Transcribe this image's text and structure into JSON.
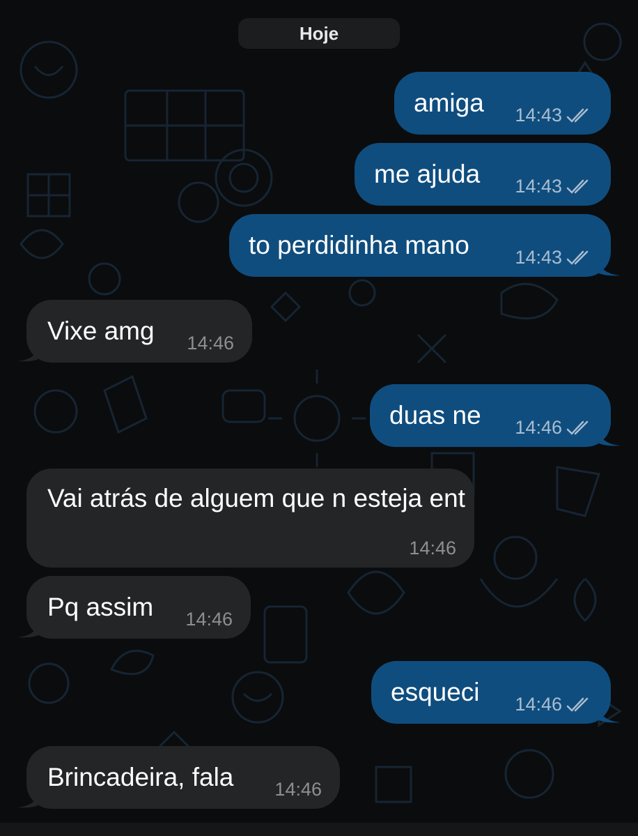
{
  "date_divider": "Hoje",
  "messages": [
    {
      "dir": "out",
      "text": "amiga",
      "time": "14:43",
      "status": "double-check-read-icon"
    },
    {
      "dir": "out",
      "text": "me ajuda",
      "time": "14:43",
      "status": "double-check-read-icon"
    },
    {
      "dir": "out",
      "text": "to perdidinha mano",
      "time": "14:43",
      "status": "double-check-read-icon"
    },
    {
      "dir": "in",
      "text": "Vixe amg",
      "time": "14:46"
    },
    {
      "dir": "out",
      "text": "duas ne",
      "time": "14:46",
      "status": "double-check-read-icon"
    },
    {
      "dir": "in",
      "text": "Vai atrás de alguem que n esteja ent",
      "time": "14:46"
    },
    {
      "dir": "in",
      "text": "Pq assim",
      "time": "14:46"
    },
    {
      "dir": "out",
      "text": "esqueci",
      "time": "14:46",
      "status": "double-check-read-icon"
    },
    {
      "dir": "in",
      "text": "Brincadeira, fala",
      "time": "14:46"
    }
  ],
  "colors": {
    "background": "#0b0c0e",
    "outgoing_bubble": "#0f4d7e",
    "incoming_bubble": "#242527",
    "date_chip": "#1c1d1f"
  }
}
